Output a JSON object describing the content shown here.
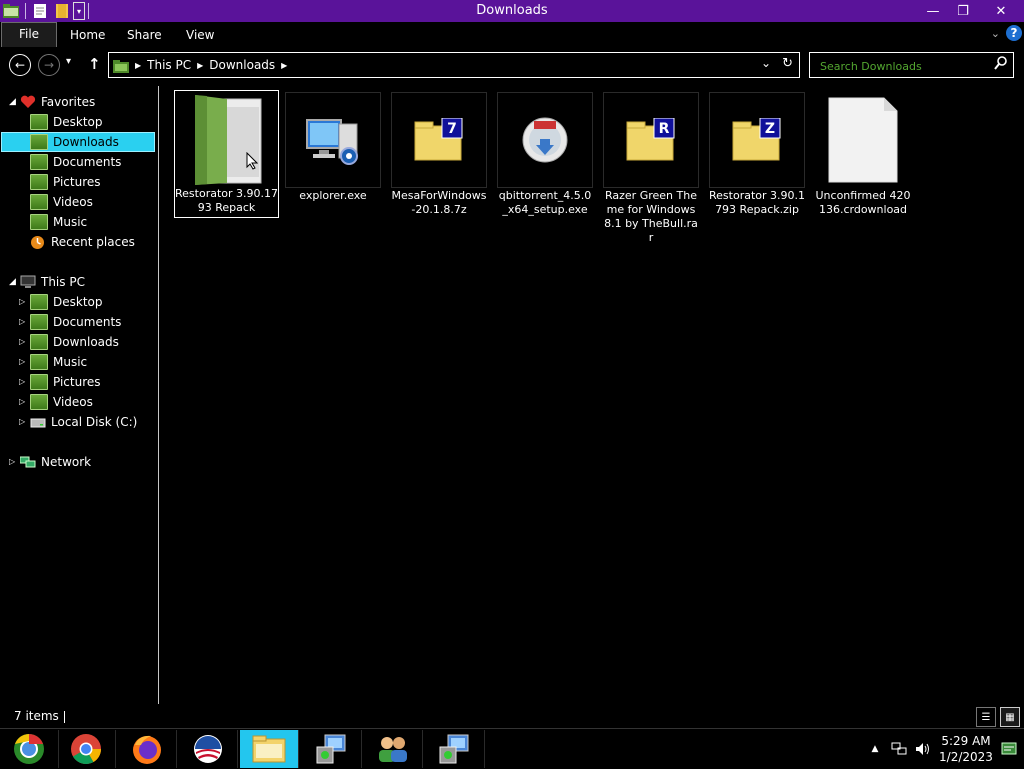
{
  "window": {
    "title": "Downloads",
    "controls": {
      "minimize": "—",
      "restore": "❐",
      "close": "✕"
    }
  },
  "ribbon": {
    "tabs": [
      "File",
      "Home",
      "Share",
      "View"
    ],
    "help": "?"
  },
  "address": {
    "back": "←",
    "forward": "→",
    "up": "↑",
    "crumbs": [
      "This PC",
      "Downloads"
    ],
    "search_placeholder": "Search Downloads"
  },
  "nav": {
    "favorites": {
      "label": "Favorites",
      "items": [
        "Desktop",
        "Downloads",
        "Documents",
        "Pictures",
        "Videos",
        "Music",
        "Recent places"
      ]
    },
    "this_pc": {
      "label": "This PC",
      "items": [
        "Desktop",
        "Documents",
        "Downloads",
        "Music",
        "Pictures",
        "Videos",
        "Local Disk (C:)"
      ]
    },
    "network": {
      "label": "Network"
    }
  },
  "files": [
    {
      "name": "Restorator 3.90.1793 Repack",
      "icon": "folder-icon"
    },
    {
      "name": "explorer.exe",
      "icon": "computer-app-icon"
    },
    {
      "name": "MesaForWindows-20.1.8.7z",
      "icon": "7z-archive-icon"
    },
    {
      "name": "qbittorrent_4.5.0_x64_setup.exe",
      "icon": "installer-icon"
    },
    {
      "name": "Razer Green Theme for Windows 8.1 by TheBull.rar",
      "icon": "rar-archive-icon"
    },
    {
      "name": "Restorator 3.90.1793 Repack.zip",
      "icon": "zip-archive-icon"
    },
    {
      "name": "Unconfirmed 420136.crdownload",
      "icon": "blank-file-icon"
    }
  ],
  "status": {
    "items": "7 items"
  },
  "taskbar": {
    "clock_time": "5:29 AM",
    "clock_date": "1/2/2023"
  },
  "colors": {
    "titlebar": "#5a139a",
    "selection": "#2ad0f0",
    "search_text": "#53a630",
    "folder_green": "#6aa83a"
  }
}
